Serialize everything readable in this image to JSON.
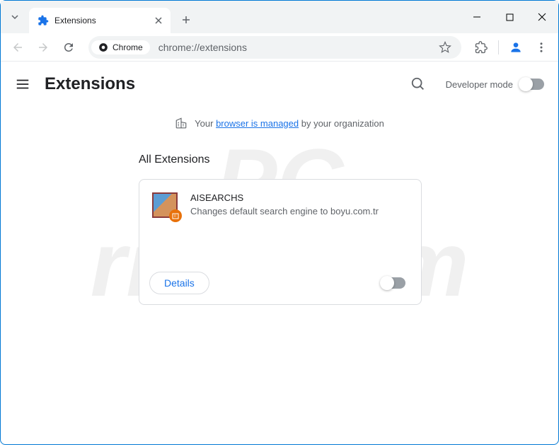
{
  "titlebar": {
    "tab_title": "Extensions"
  },
  "toolbar": {
    "chip_label": "Chrome",
    "url": "chrome://extensions"
  },
  "header": {
    "title": "Extensions",
    "dev_mode_label": "Developer mode"
  },
  "managed": {
    "prefix": "Your ",
    "link": "browser is managed",
    "suffix": " by your organization"
  },
  "content": {
    "section_title": "All Extensions",
    "extension": {
      "name": "AISEARCHS",
      "description": "Changes default search engine to boyu.com.tr",
      "details_label": "Details"
    }
  },
  "watermark": {
    "line1": "PC",
    "line2": "risk.com"
  }
}
